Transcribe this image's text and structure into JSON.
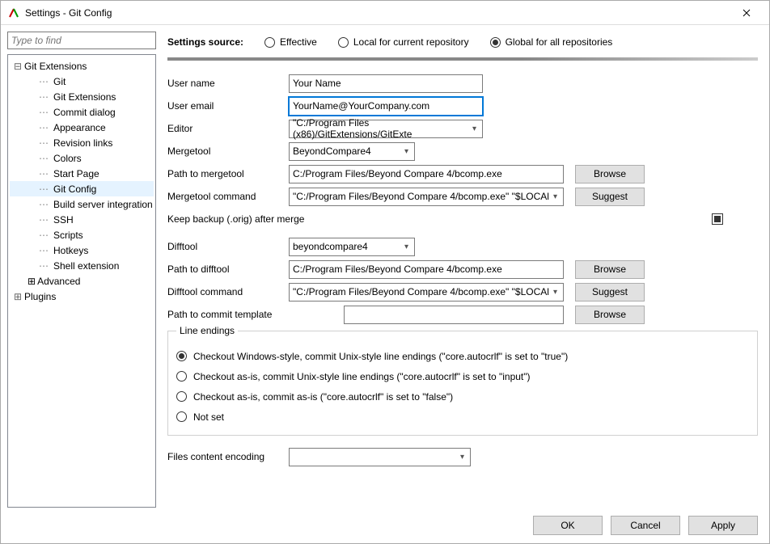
{
  "window": {
    "title": "Settings - Git Config"
  },
  "search": {
    "placeholder": "Type to find"
  },
  "tree": {
    "root": "Git Extensions",
    "items": [
      "Git",
      "Git Extensions",
      "Commit dialog",
      "Appearance",
      "Revision links",
      "Colors",
      "Start Page",
      "Git Config",
      "Build server integration",
      "SSH",
      "Scripts",
      "Hotkeys",
      "Shell extension",
      "Advanced"
    ],
    "plugins": "Plugins",
    "selected": "Git Config"
  },
  "source": {
    "label": "Settings source:",
    "effective": "Effective",
    "local": "Local for current repository",
    "global": "Global for all repositories",
    "selected": "global"
  },
  "form": {
    "username_label": "User name",
    "username": "Your Name",
    "useremail_label": "User email",
    "useremail": "YourName@YourCompany.com",
    "editor_label": "Editor",
    "editor": "\"C:/Program Files (x86)/GitExtensions/GitExte",
    "mergetool_label": "Mergetool",
    "mergetool": "BeyondCompare4",
    "mergetool_path_label": "Path to mergetool",
    "mergetool_path": "C:/Program Files/Beyond Compare 4/bcomp.exe",
    "mergetool_cmd_label": "Mergetool command",
    "mergetool_cmd": "\"C:/Program Files/Beyond Compare 4/bcomp.exe\" \"$LOCAl",
    "keep_backup_label": "Keep backup (.orig) after merge",
    "difftool_label": "Difftool",
    "difftool": "beyondcompare4",
    "difftool_path_label": "Path to difftool",
    "difftool_path": "C:/Program Files/Beyond Compare 4/bcomp.exe",
    "difftool_cmd_label": "Difftool command",
    "difftool_cmd": "\"C:/Program Files/Beyond Compare 4/bcomp.exe\" \"$LOCAl",
    "commit_tpl_label": "Path to commit template",
    "commit_tpl": "",
    "encoding_label": "Files content encoding",
    "encoding": ""
  },
  "line_endings": {
    "legend": "Line endings",
    "opt1": "Checkout Windows-style, commit Unix-style line endings (\"core.autocrlf\"  is set to \"true\")",
    "opt2": "Checkout as-is, commit Unix-style line endings (\"core.autocrlf\"  is set to \"input\")",
    "opt3": "Checkout as-is, commit as-is (\"core.autocrlf\"  is set to \"false\")",
    "opt4": "Not set",
    "selected": 1
  },
  "buttons": {
    "browse": "Browse",
    "suggest": "Suggest",
    "ok": "OK",
    "cancel": "Cancel",
    "apply": "Apply"
  }
}
